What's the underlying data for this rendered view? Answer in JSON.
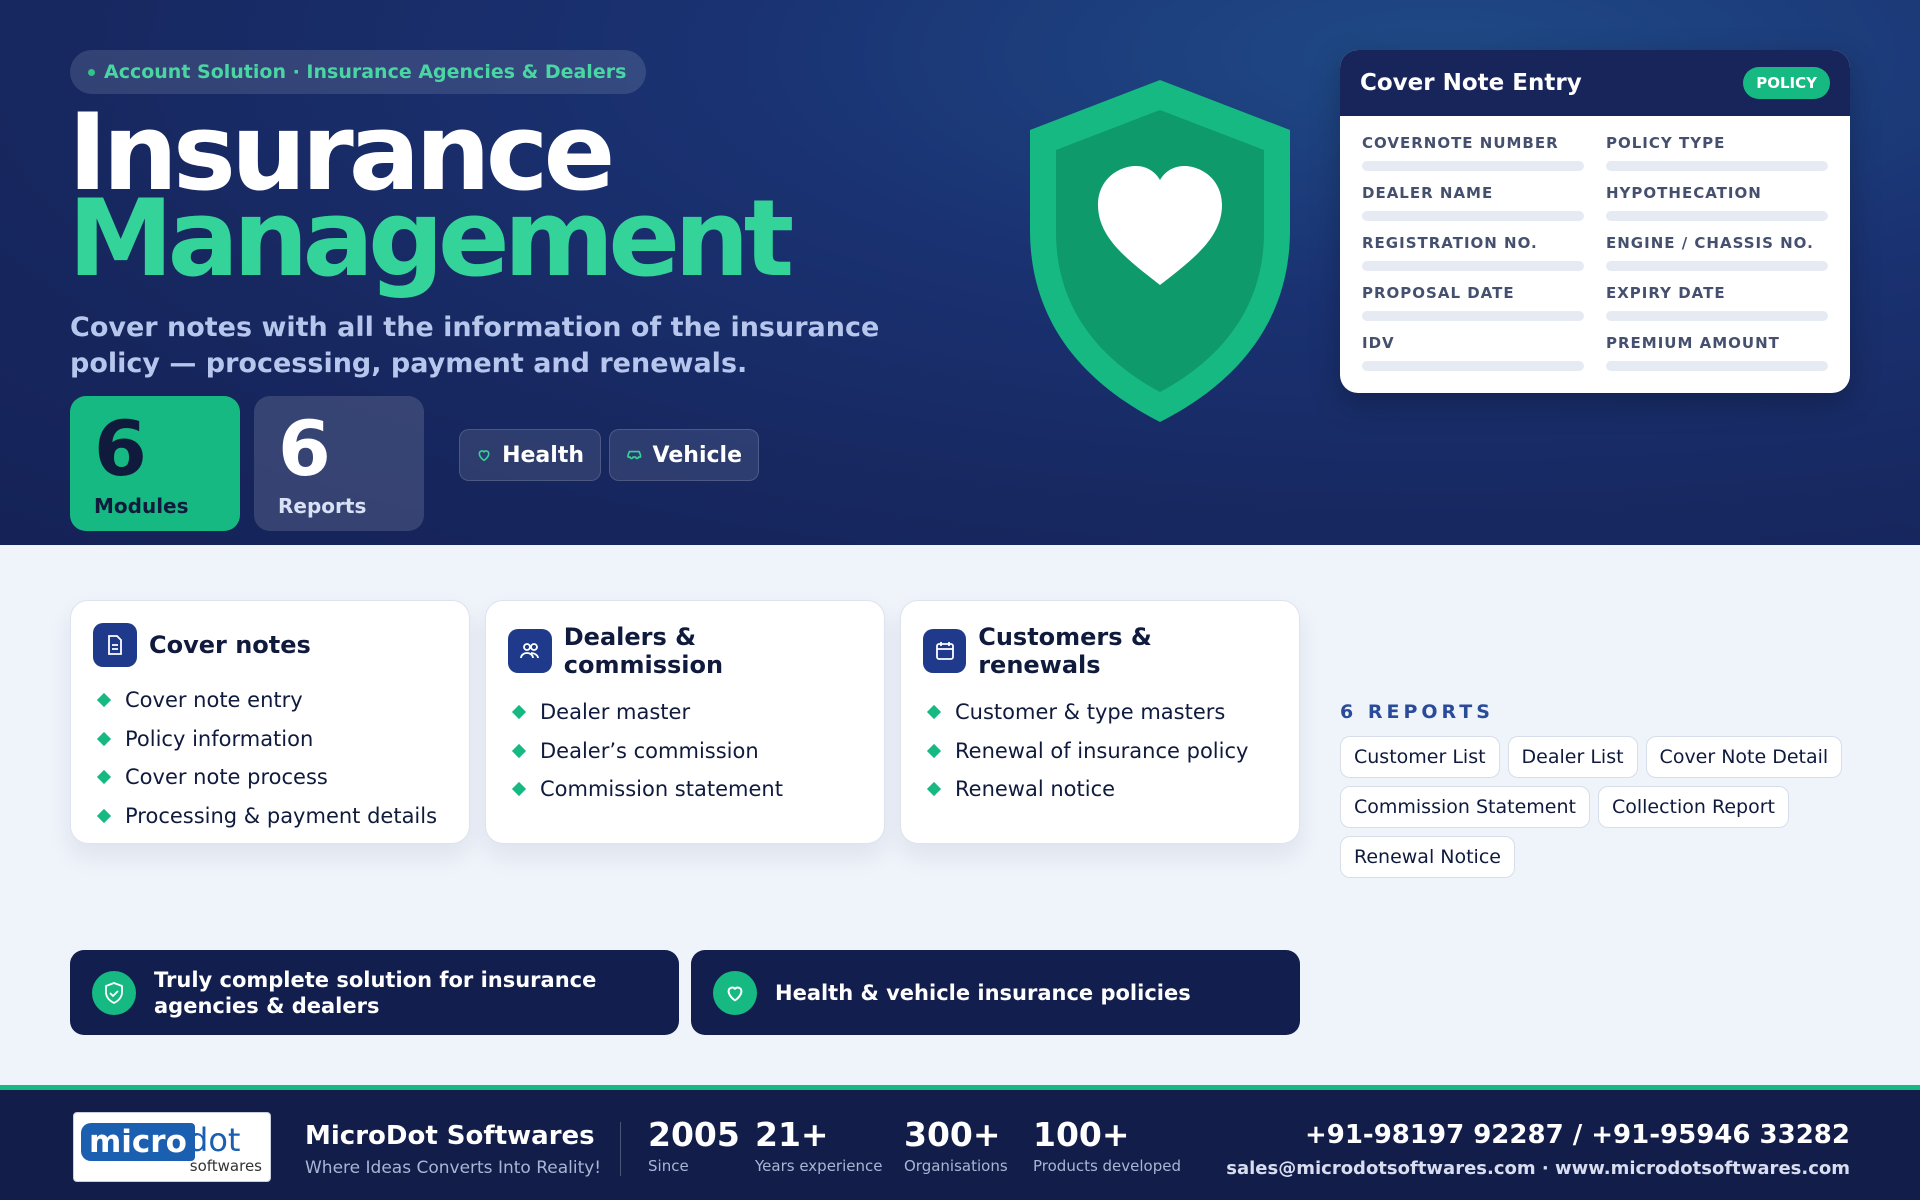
{
  "hero": {
    "eyebrow": "Account Solution · Insurance Agencies & Dealers",
    "title_line1": "Insurance",
    "title_line2": "Management",
    "subtitle": "Cover notes with all the information of the insurance policy — processing, payment and renewals.",
    "stats": [
      {
        "value": "6",
        "label": "Modules"
      },
      {
        "value": "6",
        "label": "Reports"
      }
    ],
    "pills": [
      {
        "label": "Health",
        "icon": "heart-icon"
      },
      {
        "label": "Vehicle",
        "icon": "car-icon"
      }
    ]
  },
  "form_card": {
    "title": "Cover Note Entry",
    "badge": "POLICY",
    "fields": [
      "COVERNOTE NUMBER",
      "POLICY TYPE",
      "DEALER NAME",
      "HYPOTHECATION",
      "REGISTRATION NO.",
      "ENGINE / CHASSIS NO.",
      "PROPOSAL DATE",
      "EXPIRY DATE",
      "IDV",
      "PREMIUM AMOUNT"
    ]
  },
  "modules": [
    {
      "title": "Cover notes",
      "icon": "document-icon",
      "items": [
        "Cover note entry",
        "Policy information",
        "Cover note process",
        "Processing & payment details"
      ]
    },
    {
      "title": "Dealers & commission",
      "icon": "users-icon",
      "items": [
        "Dealer master",
        "Dealer’s commission",
        "Commission statement"
      ]
    },
    {
      "title": "Customers & renewals",
      "icon": "calendar-icon",
      "items": [
        "Customer & type masters",
        "Renewal of insurance policy",
        "Renewal notice"
      ]
    }
  ],
  "reports": {
    "heading": "6 REPORTS",
    "items": [
      "Customer List",
      "Dealer List",
      "Cover Note Detail",
      "Commission Statement",
      "Collection Report",
      "Renewal Notice"
    ]
  },
  "banners": [
    {
      "text": "Truly complete solution for insurance agencies & dealers",
      "icon": "shield-check-icon"
    },
    {
      "text": "Health & vehicle insurance policies",
      "icon": "heart-icon"
    }
  ],
  "footer": {
    "logo_word": "micro",
    "logo_dot": "dot",
    "logo_sub": "softwares",
    "company": "MicroDot Softwares",
    "tagline": "Where Ideas Converts Into Reality!",
    "stats": [
      {
        "value": "2005",
        "label": "Since"
      },
      {
        "value": "21+",
        "label": "Years experience"
      },
      {
        "value": "300+",
        "label": "Organisations"
      },
      {
        "value": "100+",
        "label": "Products developed"
      }
    ],
    "phone": "+91-98197 92287 / +91-95946 33282",
    "contact": "sales@microdotsoftwares.com · www.microdotsoftwares.com"
  },
  "colors": {
    "navy": "#17275f",
    "green": "#16b981",
    "mint": "#34d399",
    "page_bg": "#eff3fa"
  }
}
